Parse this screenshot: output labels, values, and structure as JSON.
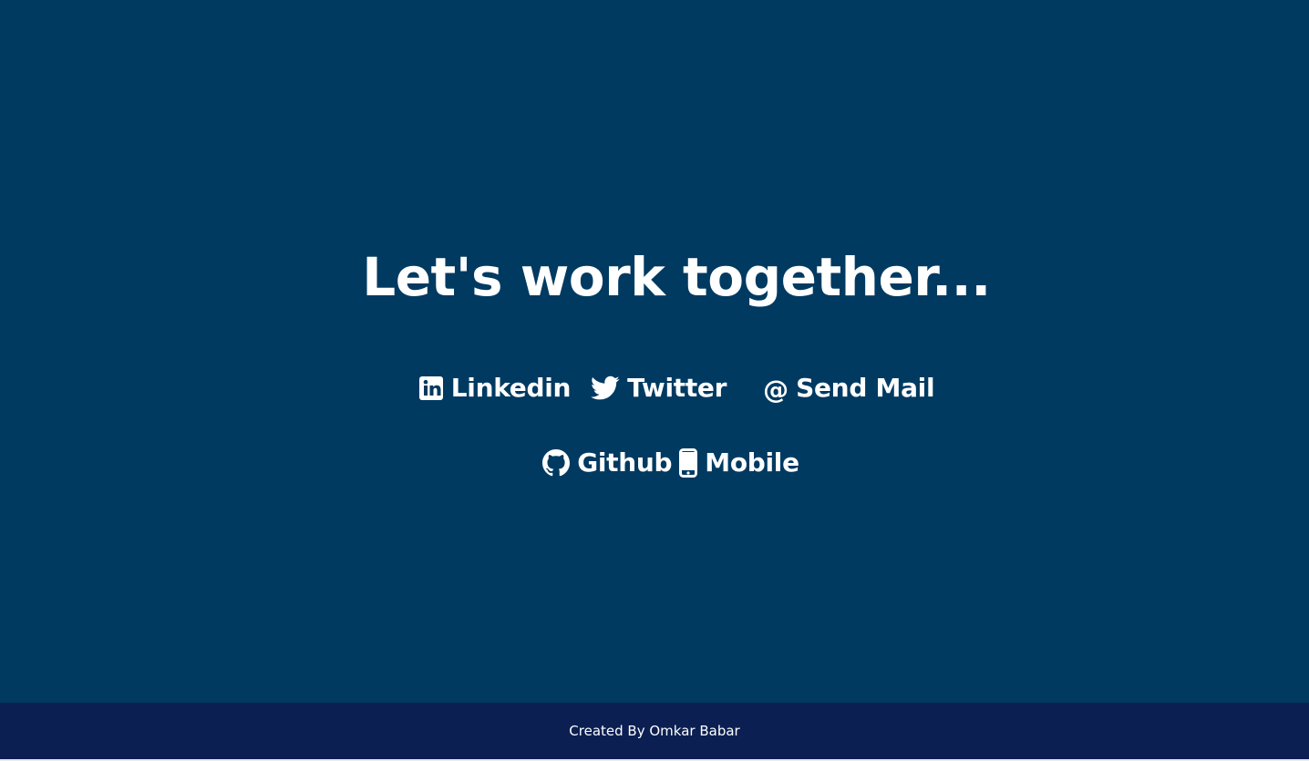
{
  "heading": "Let's work together...",
  "contact_links": [
    {
      "label": "Linkedin",
      "icon": "linkedin-icon"
    },
    {
      "label": "Twitter",
      "icon": "twitter-icon"
    },
    {
      "label": "Send Mail",
      "icon": "at-sign-icon"
    },
    {
      "label": "Github",
      "icon": "github-icon"
    },
    {
      "label": "Mobile",
      "icon": "mobile-phone-icon"
    }
  ],
  "at_symbol": "@",
  "footer": {
    "text": "Created By Omkar Babar"
  },
  "colors": {
    "background": "#003a61",
    "footer_background": "#0b1f52",
    "text": "#ffffff"
  }
}
